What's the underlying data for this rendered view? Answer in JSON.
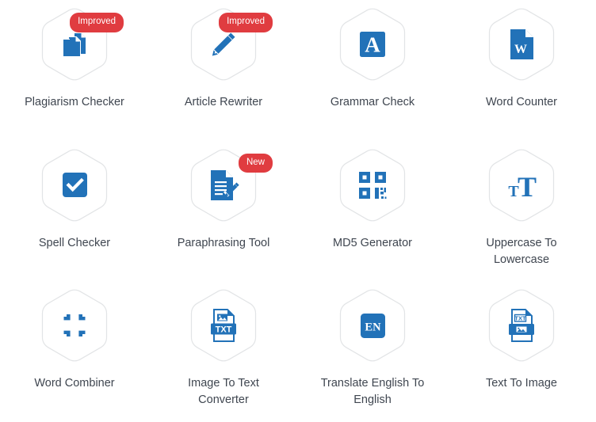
{
  "page": {
    "title": "Writing Tools Grid",
    "background_color": "#ffffff",
    "accent_color": "#2272b8",
    "badge_color": "#e03c40",
    "label_color": "#3f4650",
    "hex_border_color": "#e2e4e6",
    "columns": 4,
    "rows": 3
  },
  "tools": [
    {
      "label": "Plagiarism Checker",
      "icon": "two-documents-icon",
      "badge": "Improved",
      "has_badge": true
    },
    {
      "label": "Article Rewriter",
      "icon": "pencil-icon",
      "badge": "Improved",
      "has_badge": true
    },
    {
      "label": "Grammar Check",
      "icon": "letter-a-square-icon",
      "badge": "",
      "has_badge": false
    },
    {
      "label": "Word Counter",
      "icon": "word-document-icon",
      "badge": "",
      "has_badge": false
    },
    {
      "label": "Spell Checker",
      "icon": "checkmark-square-icon",
      "badge": "",
      "has_badge": false
    },
    {
      "label": "Paraphrasing Tool",
      "icon": "document-pencil-icon",
      "badge": "New",
      "has_badge": true
    },
    {
      "label": "MD5 Generator",
      "icon": "qr-code-icon",
      "badge": "",
      "has_badge": false
    },
    {
      "label": "Uppercase To Lowercase",
      "icon": "letter-case-tt-icon",
      "badge": "",
      "has_badge": false
    },
    {
      "label": "Word Combiner",
      "icon": "compress-arrows-icon",
      "badge": "",
      "has_badge": false
    },
    {
      "label": "Image To Text Converter",
      "icon": "image-to-txt-file-icon",
      "badge": "",
      "has_badge": false
    },
    {
      "label": "Translate English To English",
      "icon": "en-square-icon",
      "badge": "",
      "has_badge": false
    },
    {
      "label": "Text To Image",
      "icon": "txt-to-image-file-icon",
      "badge": "",
      "has_badge": false
    }
  ]
}
